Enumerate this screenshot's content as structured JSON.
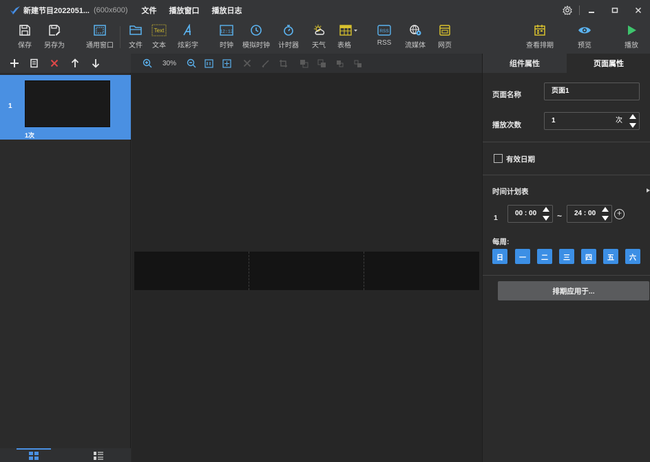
{
  "titlebar": {
    "title": "新建节目2022051...",
    "resolution": "(600x600)",
    "menu": [
      "文件",
      "播放窗口",
      "播放日志"
    ]
  },
  "toolbar": {
    "save": "保存",
    "save_as": "另存为",
    "general_window": "通用窗口",
    "file": "文件",
    "text": "文本",
    "colorful_text": "炫彩字",
    "clock": "时钟",
    "analog_clock": "模拟时钟",
    "timer": "计时器",
    "weather": "天气",
    "table": "表格",
    "rss": "RSS",
    "streaming": "流媒体",
    "webpage": "网页",
    "view_schedule": "查看排期",
    "preview": "预览",
    "play": "播放",
    "text_icon_label": "Text",
    "clock_icon_label": "12:12",
    "rss_icon_label": "RSS"
  },
  "canvas_toolbar": {
    "zoom": "30%"
  },
  "pages": [
    {
      "number": "1",
      "count": "1次"
    }
  ],
  "right_panel": {
    "tab_component": "组件属性",
    "tab_page": "页面属性",
    "page_name_label": "页面名称",
    "page_name_value": "页面1",
    "play_times_label": "播放次数",
    "play_times_value": "1",
    "play_times_unit": "次",
    "valid_date_label": "有效日期",
    "schedule_label": "时间计划表",
    "schedule_index": "1",
    "start_time": "00 : 00",
    "end_time": "24 : 00",
    "tilde": "~",
    "weekly_label": "每周:",
    "days": [
      "日",
      "一",
      "二",
      "三",
      "四",
      "五",
      "六"
    ],
    "apply_button": "排期应用于..."
  },
  "colors": {
    "accent": "#4a90e2",
    "day_button": "#3c8fe5",
    "play_green": "#3ec46d",
    "toolbar_icon": "#5bb3f0"
  }
}
